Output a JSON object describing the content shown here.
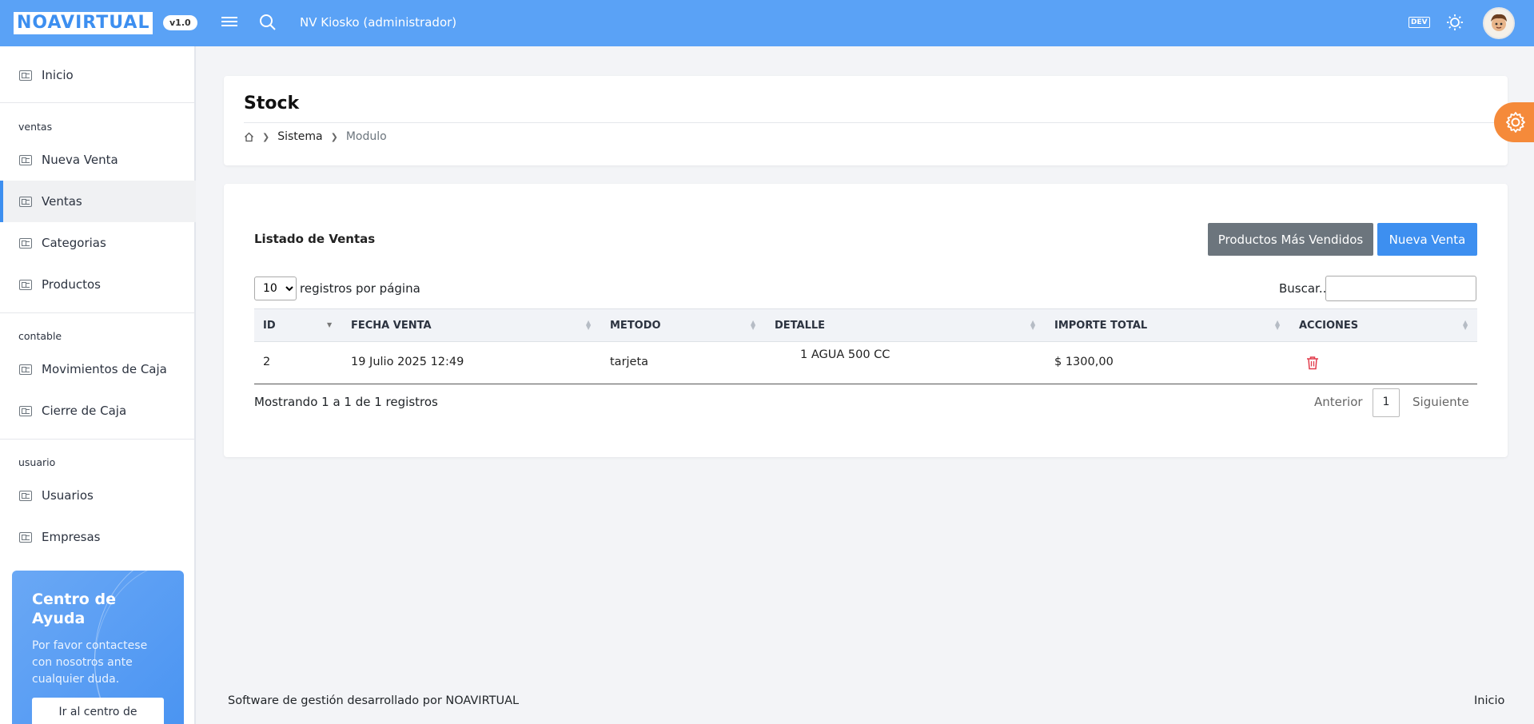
{
  "header": {
    "logo": "NOAVIRTUAL",
    "version": "v1.0",
    "title": "NV Kiosko (administrador)",
    "dev_badge": "DEV",
    "accent": "#5aa2f6"
  },
  "sidebar": {
    "home": "Inicio",
    "sections": {
      "ventas": "ventas",
      "contable": "contable",
      "usuario": "usuario"
    },
    "items": {
      "nueva_venta": "Nueva Venta",
      "ventas": "Ventas",
      "categorias": "Categorias",
      "productos": "Productos",
      "movimientos": "Movimientos de Caja",
      "cierre": "Cierre de Caja",
      "usuarios": "Usuarios",
      "empresas": "Empresas"
    },
    "help": {
      "title": "Centro de Ayuda",
      "text": "Por favor contactese con nosotros ante cualquier duda.",
      "button": "Ir al centro de"
    }
  },
  "page": {
    "title": "Stock",
    "breadcrumb": [
      "Sistema",
      "Modulo"
    ]
  },
  "list": {
    "title": "Listado de Ventas",
    "btn_top": "Productos Más Vendidos",
    "btn_new": "Nueva Venta",
    "page_size": "10",
    "page_size_label": "registros por página",
    "search_label": "Buscar...",
    "columns": [
      "ID",
      "FECHA VENTA",
      "METODO",
      "DETALLE",
      "IMPORTE TOTAL",
      "ACCIONES"
    ],
    "rows": [
      {
        "id": "2",
        "fecha": "19 Julio 2025 12:49",
        "metodo": "tarjeta",
        "detalle": "1 AGUA 500 CC",
        "importe": "$ 1300,00"
      }
    ],
    "showing": "Mostrando 1 a 1 de 1 registros",
    "prev": "Anterior",
    "current_page": "1",
    "next": "Siguiente"
  },
  "footer": {
    "left": "Software de gestión desarrollado por NOAVIRTUAL",
    "right": "Inicio"
  }
}
